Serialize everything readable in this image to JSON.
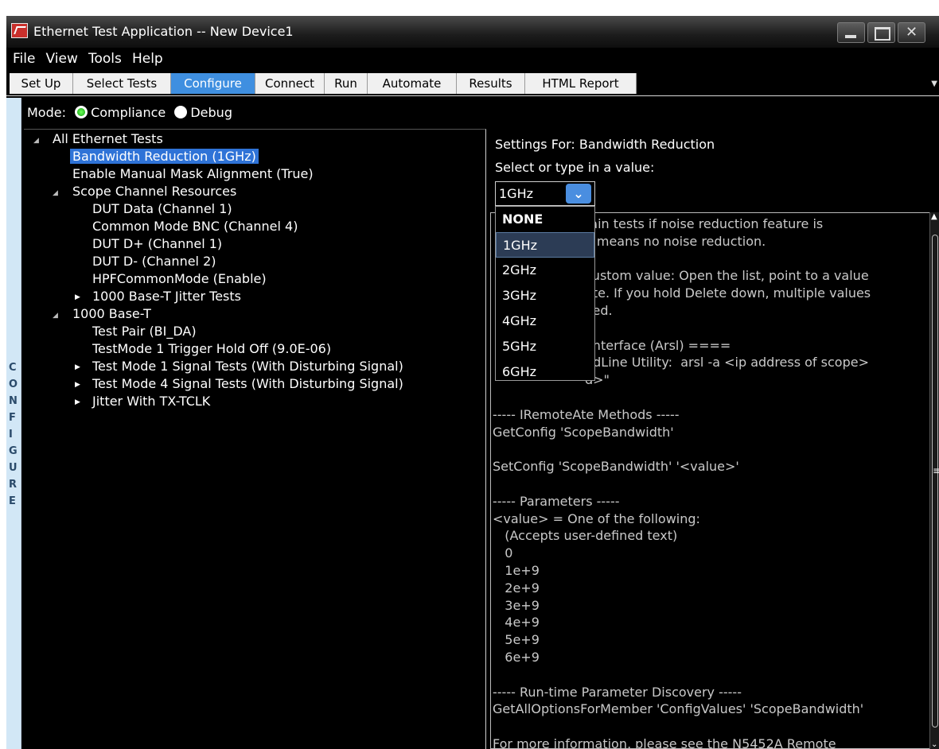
{
  "window": {
    "title": "Ethernet Test Application -- New Device1"
  },
  "menu": [
    "File",
    "View",
    "Tools",
    "Help"
  ],
  "tabs": [
    "Set Up",
    "Select Tests",
    "Configure",
    "Connect",
    "Run",
    "Automate",
    "Results",
    "HTML Report"
  ],
  "active_tab": "Configure",
  "side_label": "CONFIGURE",
  "mode": {
    "label": "Mode:",
    "options": [
      "Compliance",
      "Debug"
    ],
    "selected": "Compliance"
  },
  "tree": [
    "All Ethernet Tests",
    "Bandwidth Reduction (1GHz)",
    "Enable Manual Mask Alignment (True)",
    "Scope Channel Resources",
    "DUT Data (Channel 1)",
    "Common Mode BNC (Channel 4)",
    "DUT D+ (Channel 1)",
    "DUT D- (Channel 2)",
    "HPFCommonMode (Enable)",
    "1000 Base-T Jitter Tests",
    "1000 Base-T",
    "Test Pair (BI_DA)",
    "TestMode 1 Trigger Hold Off (9.0E-06)",
    "Test Mode 1 Signal Tests (With Disturbing Signal)",
    "Test Mode 4 Signal Tests (With Disturbing Signal)",
    "Jitter With TX-TCLK"
  ],
  "settings": {
    "title": "Settings For: Bandwidth Reduction",
    "select_label": "Select or type in a value:",
    "current_value": "1GHz",
    "options": [
      "NONE",
      "1GHz",
      "2GHz",
      "3GHz",
      "4GHz",
      "5GHz",
      "6GHz"
    ],
    "selected_option": "1GHz"
  },
  "description": [
    "tain tests if noise reduction feature is",
    "o means no noise reduction.",
    "",
    "custom value: Open the list, point to a value",
    "ete. If you hold Delete down, multiple values",
    "ved.",
    "",
    " Interface (Arsl) ====",
    "ndLine Utility:  arsl -a <ip address of scope>",
    "d>\"",
    "",
    "----- IRemoteAte Methods -----",
    "GetConfig 'ScopeBandwidth'",
    "",
    "SetConfig 'ScopeBandwidth' '<value>'",
    "",
    "----- Parameters -----",
    "<value> = One of the following:",
    "   (Accepts user-defined text)",
    "   0",
    "   1e+9",
    "   2e+9",
    "   3e+9",
    "   4e+9",
    "   5e+9",
    "   6e+9",
    "",
    "----- Run-time Parameter Discovery -----",
    "GetAllOptionsForMember 'ConfigValues' 'ScopeBandwidth'",
    "",
    "For more information, please see the N5452A Remote"
  ]
}
